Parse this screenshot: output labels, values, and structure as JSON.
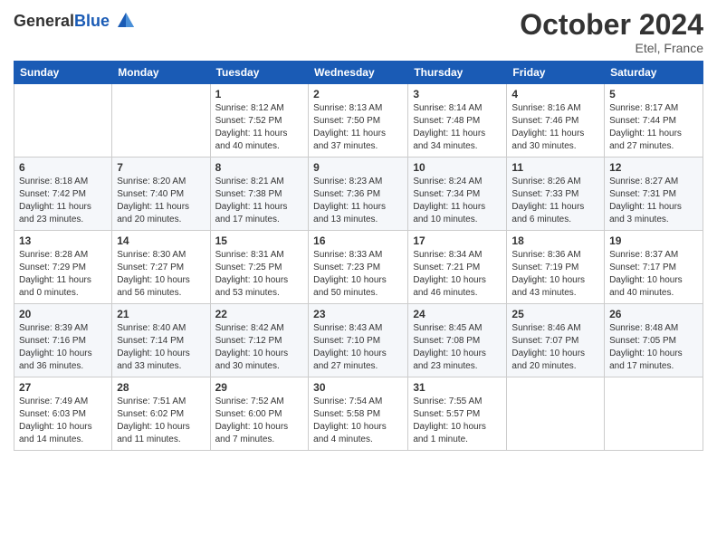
{
  "header": {
    "logo_general": "General",
    "logo_blue": "Blue",
    "month_title": "October 2024",
    "location": "Etel, France"
  },
  "weekdays": [
    "Sunday",
    "Monday",
    "Tuesday",
    "Wednesday",
    "Thursday",
    "Friday",
    "Saturday"
  ],
  "weeks": [
    [
      {
        "day": "",
        "info": ""
      },
      {
        "day": "",
        "info": ""
      },
      {
        "day": "1",
        "info": "Sunrise: 8:12 AM\nSunset: 7:52 PM\nDaylight: 11 hours and 40 minutes."
      },
      {
        "day": "2",
        "info": "Sunrise: 8:13 AM\nSunset: 7:50 PM\nDaylight: 11 hours and 37 minutes."
      },
      {
        "day": "3",
        "info": "Sunrise: 8:14 AM\nSunset: 7:48 PM\nDaylight: 11 hours and 34 minutes."
      },
      {
        "day": "4",
        "info": "Sunrise: 8:16 AM\nSunset: 7:46 PM\nDaylight: 11 hours and 30 minutes."
      },
      {
        "day": "5",
        "info": "Sunrise: 8:17 AM\nSunset: 7:44 PM\nDaylight: 11 hours and 27 minutes."
      }
    ],
    [
      {
        "day": "6",
        "info": "Sunrise: 8:18 AM\nSunset: 7:42 PM\nDaylight: 11 hours and 23 minutes."
      },
      {
        "day": "7",
        "info": "Sunrise: 8:20 AM\nSunset: 7:40 PM\nDaylight: 11 hours and 20 minutes."
      },
      {
        "day": "8",
        "info": "Sunrise: 8:21 AM\nSunset: 7:38 PM\nDaylight: 11 hours and 17 minutes."
      },
      {
        "day": "9",
        "info": "Sunrise: 8:23 AM\nSunset: 7:36 PM\nDaylight: 11 hours and 13 minutes."
      },
      {
        "day": "10",
        "info": "Sunrise: 8:24 AM\nSunset: 7:34 PM\nDaylight: 11 hours and 10 minutes."
      },
      {
        "day": "11",
        "info": "Sunrise: 8:26 AM\nSunset: 7:33 PM\nDaylight: 11 hours and 6 minutes."
      },
      {
        "day": "12",
        "info": "Sunrise: 8:27 AM\nSunset: 7:31 PM\nDaylight: 11 hours and 3 minutes."
      }
    ],
    [
      {
        "day": "13",
        "info": "Sunrise: 8:28 AM\nSunset: 7:29 PM\nDaylight: 11 hours and 0 minutes."
      },
      {
        "day": "14",
        "info": "Sunrise: 8:30 AM\nSunset: 7:27 PM\nDaylight: 10 hours and 56 minutes."
      },
      {
        "day": "15",
        "info": "Sunrise: 8:31 AM\nSunset: 7:25 PM\nDaylight: 10 hours and 53 minutes."
      },
      {
        "day": "16",
        "info": "Sunrise: 8:33 AM\nSunset: 7:23 PM\nDaylight: 10 hours and 50 minutes."
      },
      {
        "day": "17",
        "info": "Sunrise: 8:34 AM\nSunset: 7:21 PM\nDaylight: 10 hours and 46 minutes."
      },
      {
        "day": "18",
        "info": "Sunrise: 8:36 AM\nSunset: 7:19 PM\nDaylight: 10 hours and 43 minutes."
      },
      {
        "day": "19",
        "info": "Sunrise: 8:37 AM\nSunset: 7:17 PM\nDaylight: 10 hours and 40 minutes."
      }
    ],
    [
      {
        "day": "20",
        "info": "Sunrise: 8:39 AM\nSunset: 7:16 PM\nDaylight: 10 hours and 36 minutes."
      },
      {
        "day": "21",
        "info": "Sunrise: 8:40 AM\nSunset: 7:14 PM\nDaylight: 10 hours and 33 minutes."
      },
      {
        "day": "22",
        "info": "Sunrise: 8:42 AM\nSunset: 7:12 PM\nDaylight: 10 hours and 30 minutes."
      },
      {
        "day": "23",
        "info": "Sunrise: 8:43 AM\nSunset: 7:10 PM\nDaylight: 10 hours and 27 minutes."
      },
      {
        "day": "24",
        "info": "Sunrise: 8:45 AM\nSunset: 7:08 PM\nDaylight: 10 hours and 23 minutes."
      },
      {
        "day": "25",
        "info": "Sunrise: 8:46 AM\nSunset: 7:07 PM\nDaylight: 10 hours and 20 minutes."
      },
      {
        "day": "26",
        "info": "Sunrise: 8:48 AM\nSunset: 7:05 PM\nDaylight: 10 hours and 17 minutes."
      }
    ],
    [
      {
        "day": "27",
        "info": "Sunrise: 7:49 AM\nSunset: 6:03 PM\nDaylight: 10 hours and 14 minutes."
      },
      {
        "day": "28",
        "info": "Sunrise: 7:51 AM\nSunset: 6:02 PM\nDaylight: 10 hours and 11 minutes."
      },
      {
        "day": "29",
        "info": "Sunrise: 7:52 AM\nSunset: 6:00 PM\nDaylight: 10 hours and 7 minutes."
      },
      {
        "day": "30",
        "info": "Sunrise: 7:54 AM\nSunset: 5:58 PM\nDaylight: 10 hours and 4 minutes."
      },
      {
        "day": "31",
        "info": "Sunrise: 7:55 AM\nSunset: 5:57 PM\nDaylight: 10 hours and 1 minute."
      },
      {
        "day": "",
        "info": ""
      },
      {
        "day": "",
        "info": ""
      }
    ]
  ]
}
